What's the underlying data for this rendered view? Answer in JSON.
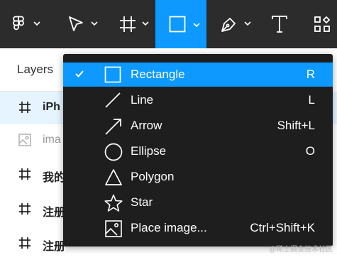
{
  "colors": {
    "toolbar_bg": "#2c2c2c",
    "accent": "#0d99ff",
    "menu_bg": "#1e1e1e",
    "selected_row": "#e5f4ff"
  },
  "toolbar": {
    "tools": [
      {
        "name": "main-menu",
        "icon": "figma-logo-icon",
        "has_dropdown": true
      },
      {
        "name": "move-tool",
        "icon": "cursor-arrow-icon",
        "has_dropdown": true
      },
      {
        "name": "frame-tool",
        "icon": "frame-hash-icon",
        "has_dropdown": true
      },
      {
        "name": "shape-tool",
        "icon": "rectangle-icon",
        "has_dropdown": true,
        "active": true
      },
      {
        "name": "pen-tool",
        "icon": "pen-nib-icon",
        "has_dropdown": true
      },
      {
        "name": "text-tool",
        "icon": "text-t-icon",
        "has_dropdown": false
      },
      {
        "name": "resources-tool",
        "icon": "components-grid-icon",
        "has_dropdown": false
      }
    ]
  },
  "panel": {
    "title": "Layers",
    "rows": [
      {
        "icon": "frame-hash-icon",
        "label": "iPh",
        "selected": true
      },
      {
        "icon": "image-icon",
        "label": "ima",
        "light": true
      },
      {
        "icon": "frame-hash-icon",
        "label": "我的"
      },
      {
        "icon": "frame-hash-icon",
        "label": "注册"
      },
      {
        "icon": "frame-hash-icon",
        "label": "注册"
      }
    ]
  },
  "menu": {
    "items": [
      {
        "label": "Rectangle",
        "shortcut": "R",
        "icon": "rectangle-icon",
        "checked": true,
        "highlighted": true
      },
      {
        "label": "Line",
        "shortcut": "L",
        "icon": "line-icon"
      },
      {
        "label": "Arrow",
        "shortcut": "Shift+L",
        "icon": "arrow-icon"
      },
      {
        "label": "Ellipse",
        "shortcut": "O",
        "icon": "ellipse-icon"
      },
      {
        "label": "Polygon",
        "shortcut": "",
        "icon": "polygon-icon"
      },
      {
        "label": "Star",
        "shortcut": "",
        "icon": "star-icon"
      },
      {
        "label": "Place image...",
        "shortcut": "Ctrl+Shift+K",
        "icon": "place-image-icon"
      }
    ]
  },
  "watermark": "@稀土掘金技术社区"
}
